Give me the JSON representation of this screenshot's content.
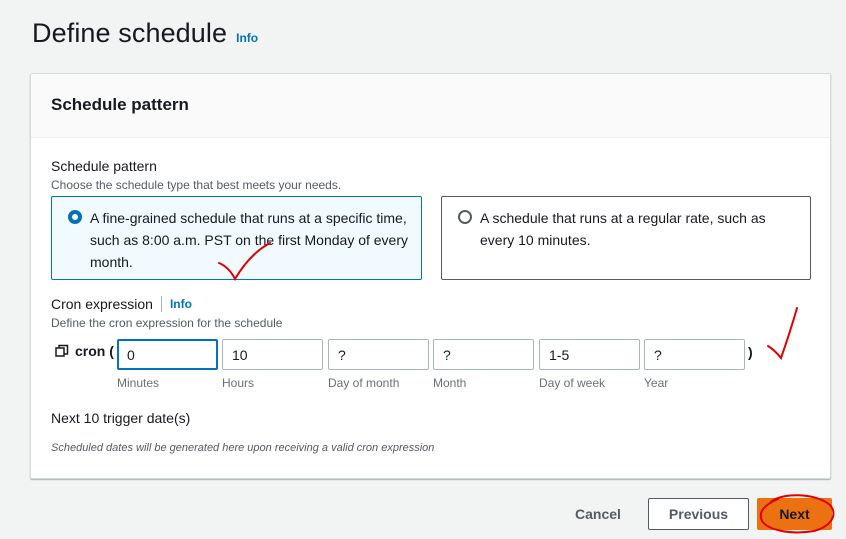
{
  "page": {
    "title": "Define schedule",
    "info": "Info"
  },
  "panel": {
    "title": "Schedule pattern"
  },
  "schedule_pattern": {
    "label": "Schedule pattern",
    "description": "Choose the schedule type that best meets your needs.",
    "options": [
      {
        "label": "A fine-grained schedule that runs at a specific time, such as 8:00 a.m. PST on the first Monday of every month.",
        "selected": true
      },
      {
        "label": "A schedule that runs at a regular rate, such as every 10 minutes.",
        "selected": false
      }
    ]
  },
  "cron": {
    "label": "Cron expression",
    "info": "Info",
    "description": "Define the cron expression for the schedule",
    "prefix": "cron (",
    "suffix": ")",
    "fields": [
      {
        "label": "Minutes",
        "value": "0"
      },
      {
        "label": "Hours",
        "value": "10"
      },
      {
        "label": "Day of month",
        "value": "?"
      },
      {
        "label": "Month",
        "value": "?"
      },
      {
        "label": "Day of week",
        "value": "1-5"
      },
      {
        "label": "Year",
        "value": "?"
      }
    ]
  },
  "triggers": {
    "title": "Next 10 trigger date(s)",
    "note": "Scheduled dates will be generated here upon receiving a valid cron expression"
  },
  "footer": {
    "cancel": "Cancel",
    "previous": "Previous",
    "next": "Next"
  },
  "colors": {
    "accent": "#0073bb",
    "primary_button": "#ec7211",
    "annotation": "#e00000"
  }
}
